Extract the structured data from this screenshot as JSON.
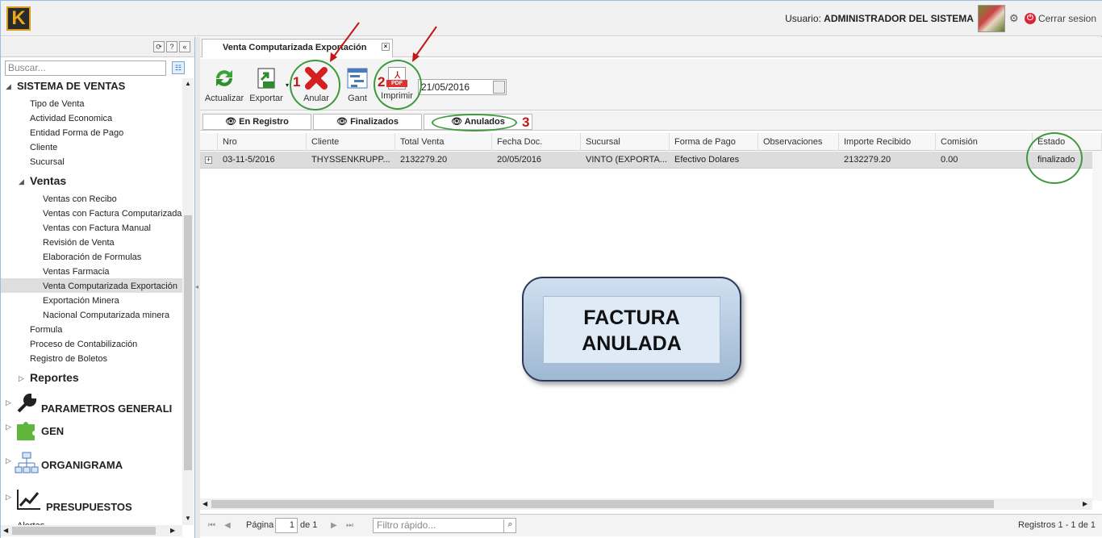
{
  "header": {
    "logo_letter": "K",
    "user_label": "Usuario:",
    "user_name": "ADMINISTRADOR DEL SISTEMA",
    "logout_label": "Cerrar sesion"
  },
  "sidebar": {
    "search_placeholder": "Buscar...",
    "tree": {
      "root": "SISTEMA DE VENTAS",
      "top_items": [
        "Tipo de Venta",
        "Actividad Economica",
        "Entidad Forma de Pago",
        "Cliente",
        "Sucursal"
      ],
      "ventas_label": "Ventas",
      "ventas_items": [
        "Ventas con Recibo",
        "Ventas con Factura Computarizada",
        "Ventas con Factura Manual",
        "Revisión de Venta",
        "Elaboración de Formulas",
        "Ventas Farmacia",
        "Venta Computarizada Exportación",
        "Exportación Minera",
        "Nacional Computarizada minera"
      ],
      "bottom_items": [
        "Formula",
        "Proceso de Contabilización",
        "Registro de Boletos"
      ],
      "reportes_label": "Reportes",
      "modules": [
        "PARAMETROS GENERALI",
        "GEN",
        "ORGANIGRAMA",
        "PRESUPUESTOS"
      ],
      "cut_item": "Alertas"
    }
  },
  "main": {
    "tab_title": "Venta Computarizada Exportación",
    "toolbar": {
      "actualizar": "Actualizar",
      "exportar": "Exportar",
      "anular": "Anular",
      "gant": "Gant",
      "imprimir": "Imprimir",
      "pdf_tag": "PDF",
      "date": "21/05/2016"
    },
    "subtabs": [
      "En Registro",
      "Finalizados",
      "Anulados"
    ],
    "grid": {
      "columns": [
        "Nro",
        "Cliente",
        "Total Venta",
        "Fecha Doc.",
        "Sucursal",
        "Forma de Pago",
        "Observaciones",
        "Importe Recibido",
        "Comisión",
        "Estado"
      ],
      "row": [
        "03-11-5/2016",
        "THYSSENKRUPP...",
        "2132279.20",
        "20/05/2016",
        "VINTO (EXPORTA...",
        "Efectivo Dolares",
        "",
        "2132279.20",
        "0.00",
        "finalizado"
      ]
    },
    "paging": {
      "page_label": "Página",
      "page_value": "1",
      "of_label": "de 1",
      "quick_filter_placeholder": "Filtro rápido...",
      "records": "Registros 1 - 1 de 1"
    }
  },
  "annotations": {
    "n1": "1",
    "n2": "2",
    "n3": "3",
    "callout_line1": "FACTURA",
    "callout_line2": "ANULADA"
  },
  "colors": {
    "accent": "#99bbe8",
    "annotation_ring": "#3c9a3c",
    "annotation_number": "#c01818",
    "selected_row": "#dcdcdc"
  }
}
